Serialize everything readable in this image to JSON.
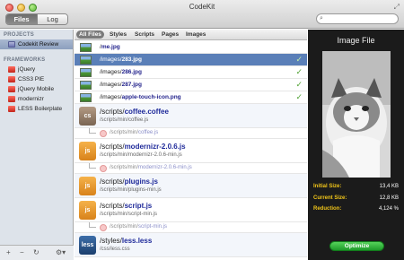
{
  "window": {
    "title": "CodeKit"
  },
  "toolbar": {
    "tabs": [
      "Files",
      "Log"
    ],
    "active_tab": "Files",
    "search_placeholder": ""
  },
  "sidebar": {
    "projects_header": "PROJECTS",
    "projects": [
      {
        "label": "Codekit Review",
        "selected": true
      }
    ],
    "frameworks_header": "FRAMEWORKS",
    "frameworks": [
      {
        "label": "jQuery"
      },
      {
        "label": "CSS3 PIE"
      },
      {
        "label": "jQuery Mobile"
      },
      {
        "label": "modernizr"
      },
      {
        "label": "LESS Boilerplate"
      }
    ],
    "bottom_icons": [
      "add-icon",
      "remove-icon",
      "refresh-icon",
      "gear-icon"
    ]
  },
  "filters": {
    "items": [
      "All Files",
      "Styles",
      "Scripts",
      "Pages",
      "Images"
    ],
    "active": "All Files"
  },
  "images": [
    {
      "dir": "/",
      "file": "me.jpg",
      "checked": false,
      "selected": false
    },
    {
      "dir": "/images/",
      "file": "283.jpg",
      "checked": true,
      "selected": true
    },
    {
      "dir": "/images/",
      "file": "286.jpg",
      "checked": true,
      "selected": false
    },
    {
      "dir": "/images/",
      "file": "287.jpg",
      "checked": true,
      "selected": false
    },
    {
      "dir": "/images/",
      "file": "apple-touch-icon.png",
      "checked": true,
      "selected": false
    }
  ],
  "scripts": [
    {
      "badge": "cs",
      "dir": "/scripts/",
      "file": "coffee.coffee",
      "output": "/scripts/min/coffee.js",
      "child": {
        "dir": "/scripts/min/",
        "file": "coffee.js"
      }
    },
    {
      "badge": "js",
      "dir": "/scripts/",
      "file": "modernizr-2.0.6.js",
      "output": "/scripts/min/modernizr-2.0.6-min.js",
      "child": {
        "dir": "/scripts/min/",
        "file": "modernizr-2.0.6-min.js"
      }
    },
    {
      "badge": "js",
      "dir": "/scripts/",
      "file": "plugins.js",
      "output": "/scripts/min/plugins-min.js",
      "child": null
    },
    {
      "badge": "js",
      "dir": "/scripts/",
      "file": "script.js",
      "output": "/scripts/min/script-min.js",
      "child": {
        "dir": "/scripts/min/",
        "file": "script-min.js"
      }
    },
    {
      "badge": "less",
      "dir": "/styles/",
      "file": "less.less",
      "output": "/css/less.css",
      "child": null
    }
  ],
  "inspector": {
    "title": "Image File",
    "stats": [
      {
        "label": "Initial Size:",
        "value": "13,4 KB"
      },
      {
        "label": "Current Size:",
        "value": "12,8 KB"
      },
      {
        "label": "Reduction:",
        "value": "4,124 %"
      }
    ],
    "button": "Optimize"
  },
  "colors": {
    "selection": "#5a7fb8",
    "accent": "#f0c419",
    "optimize": "#2aa834",
    "check": "#52a335"
  }
}
